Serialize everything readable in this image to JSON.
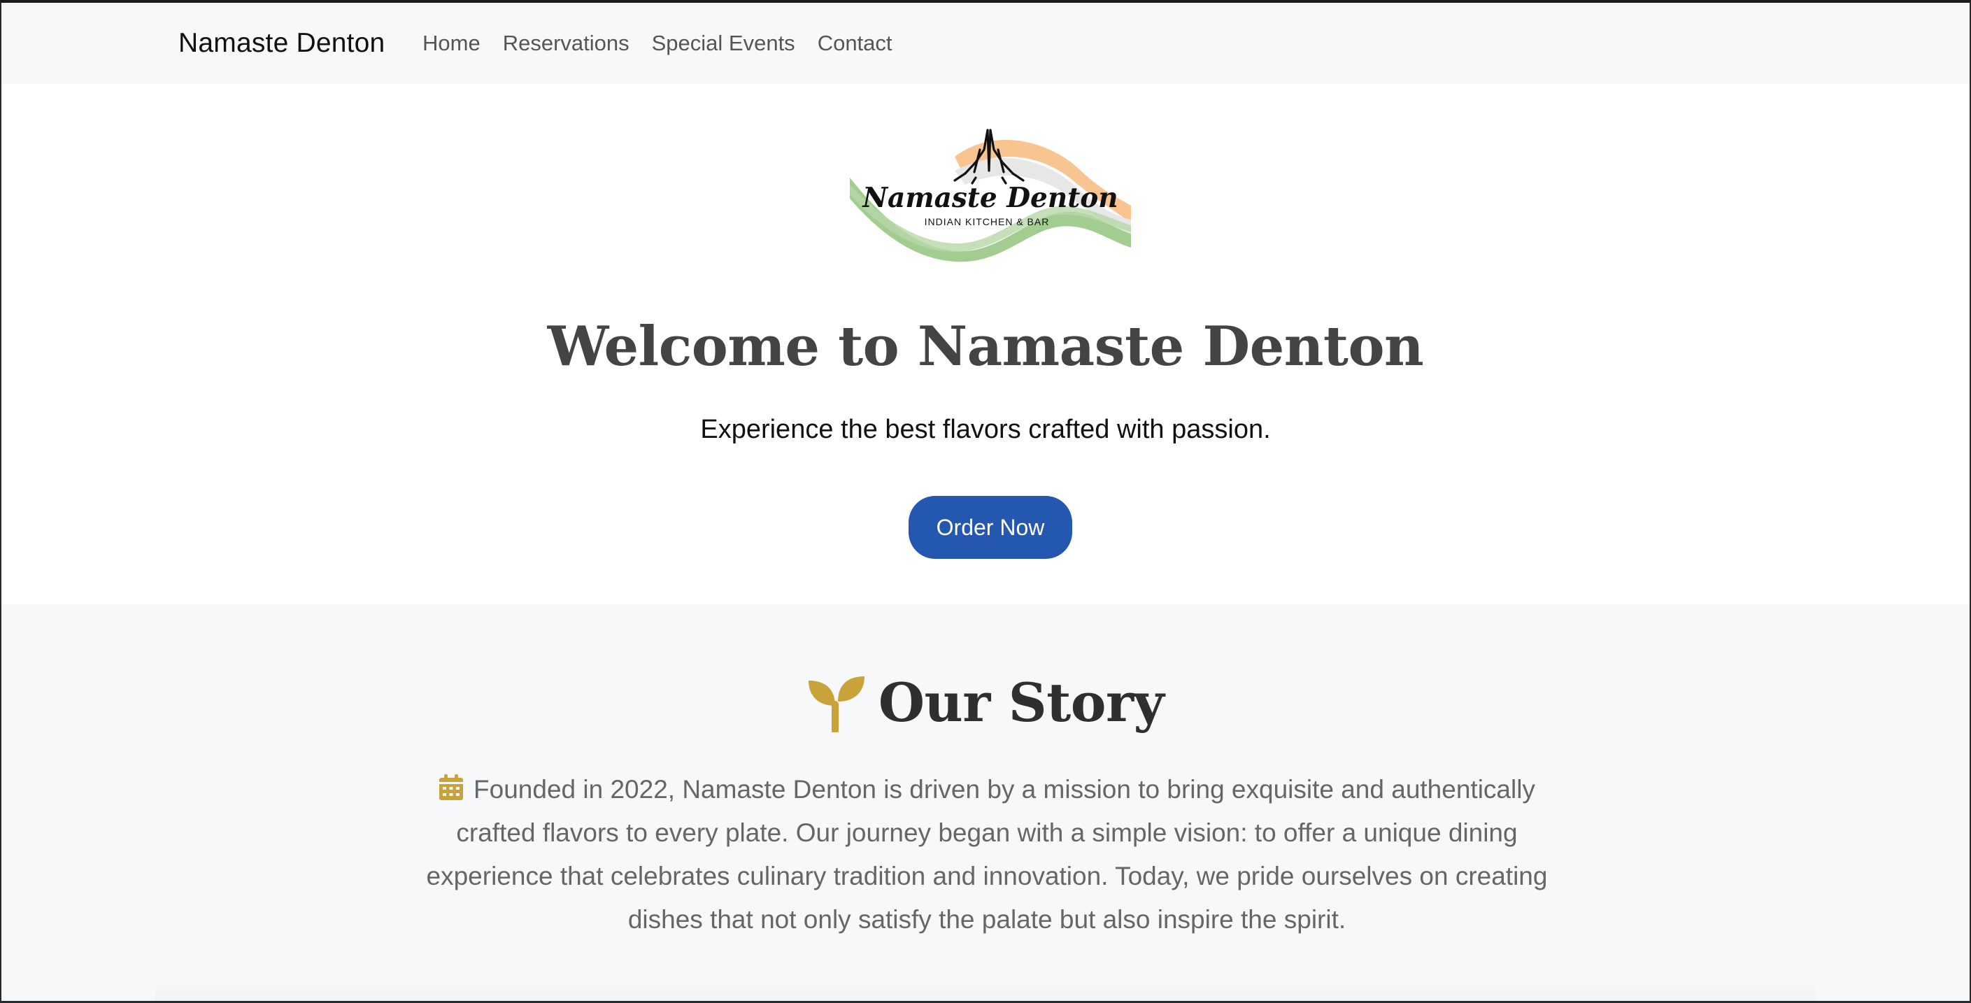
{
  "navbar": {
    "brand": "Namaste Denton",
    "links": [
      {
        "label": "Home"
      },
      {
        "label": "Reservations"
      },
      {
        "label": "Special Events"
      },
      {
        "label": "Contact"
      }
    ]
  },
  "hero": {
    "logo": {
      "name": "Namaste Denton",
      "tagline": "INDIAN KITCHEN & BAR",
      "colors": {
        "saffron": "#f6b26b",
        "green": "#93c47d"
      }
    },
    "title": "Welcome to Namaste Denton",
    "subtitle": "Experience the best flavors crafted with passion.",
    "cta_label": "Order Now",
    "cta_color": "#2357b0"
  },
  "story": {
    "icon": "sprout-icon",
    "title": "Our Story",
    "text_icon": "calendar-icon",
    "text": "Founded in 2022, Namaste Denton is driven by a mission to bring exquisite and authentically crafted flavors to every plate. Our journey began with a simple vision: to offer a unique dining experience that celebrates culinary tradition and innovation. Today, we pride ourselves on creating dishes that not only satisfy the palate but also inspire the spirit.",
    "accent_color": "#c9a23a"
  }
}
